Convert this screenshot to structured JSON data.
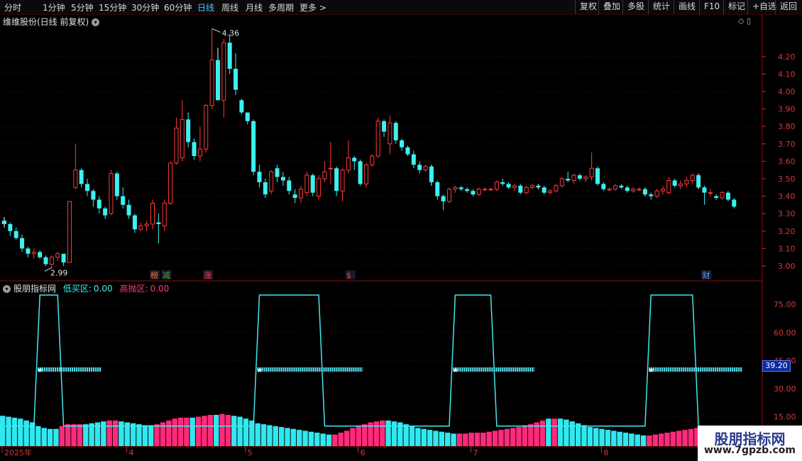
{
  "toolbar": {
    "periods": [
      "分时",
      "1分钟",
      "5分钟",
      "15分钟",
      "30分钟",
      "60分钟",
      "日线",
      "周线",
      "月线",
      "多周期",
      "更多 >"
    ],
    "active_period": "日线",
    "right_buttons": [
      "复权",
      "叠加",
      "多股",
      "统计",
      "画线",
      "F10",
      "标记",
      "+自选",
      "返回"
    ]
  },
  "chart": {
    "title": "维维股份(日线 前复权)",
    "high_label": "4.36",
    "low_label": "2.99",
    "y_ticks": [
      "4.20",
      "4.10",
      "4.00",
      "3.90",
      "3.80",
      "3.70",
      "3.60",
      "3.50",
      "3.40",
      "3.30",
      "3.20",
      "3.10",
      "3.00"
    ],
    "markers": [
      {
        "text": "榜",
        "color": "#ff7030"
      },
      {
        "text": "减",
        "color": "#2fb52f"
      },
      {
        "text": "涨",
        "color": "#ff4040"
      },
      {
        "text": "$",
        "color": "#ff4040"
      },
      {
        "text": "财",
        "color": "#4aa0ff"
      }
    ]
  },
  "indicator": {
    "name": "股朋指标网",
    "low_buy_label": "低买区:",
    "low_buy_value": "0.00",
    "high_sell_label": "高抛区:",
    "high_sell_value": "0.00",
    "y_ticks": [
      "75.00",
      "60.00",
      "45.00",
      "30.00",
      "15.00"
    ],
    "current_value": "39.20"
  },
  "x_axis": {
    "labels": [
      "2025年",
      "4",
      "5",
      "6",
      "7",
      "8"
    ]
  },
  "watermark": {
    "title": "股朋指标网",
    "url": "www.7gpzb.com"
  },
  "colors": {
    "up": "#ff3a3a",
    "down": "#3ef0f0",
    "pink": "#ff2a7a",
    "accent_active": "#4ec0ff"
  },
  "candles": [
    [
      3.26,
      3.28,
      3.22,
      3.24
    ],
    [
      3.24,
      3.25,
      3.17,
      3.2
    ],
    [
      3.2,
      3.22,
      3.15,
      3.16
    ],
    [
      3.16,
      3.18,
      3.08,
      3.1
    ],
    [
      3.1,
      3.11,
      3.05,
      3.07
    ],
    [
      3.07,
      3.1,
      3.04,
      3.08
    ],
    [
      3.08,
      3.09,
      3.04,
      3.05
    ],
    [
      3.05,
      3.06,
      3.0,
      3.01
    ],
    [
      3.01,
      3.06,
      2.99,
      3.05
    ],
    [
      3.05,
      3.08,
      3.03,
      3.07
    ],
    [
      3.07,
      3.07,
      3.0,
      3.02
    ],
    [
      3.02,
      3.37,
      3.02,
      3.37
    ],
    [
      3.45,
      3.7,
      3.44,
      3.55
    ],
    [
      3.55,
      3.56,
      3.45,
      3.47
    ],
    [
      3.47,
      3.5,
      3.4,
      3.43
    ],
    [
      3.43,
      3.44,
      3.34,
      3.38
    ],
    [
      3.38,
      3.4,
      3.3,
      3.33
    ],
    [
      3.33,
      3.34,
      3.27,
      3.29
    ],
    [
      3.3,
      3.55,
      3.29,
      3.53
    ],
    [
      3.53,
      3.54,
      3.38,
      3.4
    ],
    [
      3.4,
      3.45,
      3.33,
      3.35
    ],
    [
      3.35,
      3.38,
      3.27,
      3.29
    ],
    [
      3.29,
      3.3,
      3.19,
      3.21
    ],
    [
      3.21,
      3.25,
      3.2,
      3.23
    ],
    [
      3.23,
      3.26,
      3.2,
      3.24
    ],
    [
      3.24,
      3.38,
      3.21,
      3.36
    ],
    [
      3.25,
      3.3,
      3.13,
      3.24
    ],
    [
      3.23,
      3.38,
      3.2,
      3.36
    ],
    [
      3.36,
      3.6,
      3.35,
      3.59
    ],
    [
      3.59,
      3.85,
      3.58,
      3.79
    ],
    [
      3.62,
      3.95,
      3.6,
      3.84
    ],
    [
      3.84,
      3.88,
      3.68,
      3.71
    ],
    [
      3.71,
      3.73,
      3.61,
      3.63
    ],
    [
      3.63,
      3.8,
      3.6,
      3.67
    ],
    [
      3.67,
      3.93,
      3.65,
      3.92
    ],
    [
      3.92,
      4.36,
      3.9,
      4.18
    ],
    [
      4.18,
      4.25,
      4.05,
      3.95
    ],
    [
      3.95,
      4.3,
      3.85,
      4.28
    ],
    [
      4.28,
      4.33,
      4.1,
      4.13
    ],
    [
      4.13,
      4.22,
      3.98,
      4.01
    ],
    [
      3.95,
      3.96,
      3.87,
      3.88
    ],
    [
      3.88,
      3.88,
      3.81,
      3.83
    ],
    [
      3.83,
      3.84,
      3.52,
      3.54
    ],
    [
      3.54,
      3.58,
      3.45,
      3.48
    ],
    [
      3.48,
      3.5,
      3.39,
      3.41
    ],
    [
      3.43,
      3.55,
      3.41,
      3.54
    ],
    [
      3.56,
      3.58,
      3.48,
      3.51
    ],
    [
      3.51,
      3.54,
      3.46,
      3.49
    ],
    [
      3.49,
      3.51,
      3.41,
      3.43
    ],
    [
      3.41,
      3.44,
      3.36,
      3.39
    ],
    [
      3.39,
      3.46,
      3.36,
      3.44
    ],
    [
      3.42,
      3.54,
      3.4,
      3.52
    ],
    [
      3.52,
      3.53,
      3.4,
      3.42
    ],
    [
      3.4,
      3.52,
      3.38,
      3.5
    ],
    [
      3.5,
      3.6,
      3.48,
      3.54
    ],
    [
      3.56,
      3.71,
      3.47,
      3.56
    ],
    [
      3.56,
      3.57,
      3.4,
      3.43
    ],
    [
      3.43,
      3.56,
      3.37,
      3.55
    ],
    [
      3.55,
      3.72,
      3.53,
      3.62
    ],
    [
      3.62,
      3.63,
      3.55,
      3.6
    ],
    [
      3.6,
      3.61,
      3.46,
      3.47
    ],
    [
      3.47,
      3.59,
      3.45,
      3.58
    ],
    [
      3.58,
      3.64,
      3.57,
      3.63
    ],
    [
      3.63,
      3.85,
      3.62,
      3.83
    ],
    [
      3.83,
      3.84,
      3.74,
      3.77
    ],
    [
      3.7,
      3.86,
      3.64,
      3.82
    ],
    [
      3.82,
      3.83,
      3.7,
      3.72
    ],
    [
      3.72,
      3.73,
      3.66,
      3.68
    ],
    [
      3.68,
      3.69,
      3.63,
      3.64
    ],
    [
      3.64,
      3.66,
      3.56,
      3.58
    ],
    [
      3.58,
      3.6,
      3.53,
      3.55
    ],
    [
      3.55,
      3.58,
      3.54,
      3.57
    ],
    [
      3.57,
      3.58,
      3.46,
      3.48
    ],
    [
      3.48,
      3.49,
      3.38,
      3.4
    ],
    [
      3.4,
      3.41,
      3.32,
      3.37
    ],
    [
      3.37,
      3.45,
      3.36,
      3.44
    ],
    [
      3.44,
      3.46,
      3.42,
      3.45
    ],
    [
      3.45,
      3.46,
      3.43,
      3.44
    ],
    [
      3.44,
      3.45,
      3.42,
      3.43
    ],
    [
      3.43,
      3.44,
      3.4,
      3.41
    ],
    [
      3.41,
      3.45,
      3.4,
      3.44
    ],
    [
      3.44,
      3.45,
      3.43,
      3.44
    ],
    [
      3.44,
      3.45,
      3.43,
      3.44
    ],
    [
      3.44,
      3.49,
      3.43,
      3.48
    ],
    [
      3.48,
      3.5,
      3.46,
      3.47
    ],
    [
      3.47,
      3.48,
      3.44,
      3.45
    ],
    [
      3.45,
      3.47,
      3.43,
      3.46
    ],
    [
      3.46,
      3.47,
      3.41,
      3.42
    ],
    [
      3.42,
      3.46,
      3.41,
      3.45
    ],
    [
      3.45,
      3.47,
      3.44,
      3.46
    ],
    [
      3.46,
      3.47,
      3.44,
      3.45
    ],
    [
      3.45,
      3.46,
      3.41,
      3.42
    ],
    [
      3.42,
      3.44,
      3.41,
      3.43
    ],
    [
      3.43,
      3.47,
      3.42,
      3.46
    ],
    [
      3.46,
      3.51,
      3.45,
      3.5
    ],
    [
      3.5,
      3.54,
      3.48,
      3.49
    ],
    [
      3.49,
      3.53,
      3.47,
      3.52
    ],
    [
      3.52,
      3.53,
      3.49,
      3.5
    ],
    [
      3.5,
      3.52,
      3.48,
      3.51
    ],
    [
      3.51,
      3.65,
      3.49,
      3.56
    ],
    [
      3.56,
      3.57,
      3.46,
      3.47
    ],
    [
      3.47,
      3.48,
      3.43,
      3.44
    ],
    [
      3.44,
      3.45,
      3.43,
      3.44
    ],
    [
      3.44,
      3.47,
      3.43,
      3.46
    ],
    [
      3.46,
      3.47,
      3.44,
      3.45
    ],
    [
      3.45,
      3.46,
      3.42,
      3.43
    ],
    [
      3.43,
      3.45,
      3.42,
      3.44
    ],
    [
      3.44,
      3.45,
      3.43,
      3.44
    ],
    [
      3.44,
      3.45,
      3.4,
      3.41
    ],
    [
      3.41,
      3.42,
      3.38,
      3.4
    ],
    [
      3.4,
      3.44,
      3.39,
      3.43
    ],
    [
      3.43,
      3.46,
      3.41,
      3.44
    ],
    [
      3.42,
      3.51,
      3.41,
      3.49
    ],
    [
      3.49,
      3.5,
      3.45,
      3.46
    ],
    [
      3.46,
      3.49,
      3.44,
      3.47
    ],
    [
      3.47,
      3.51,
      3.45,
      3.49
    ],
    [
      3.49,
      3.53,
      3.47,
      3.52
    ],
    [
      3.52,
      3.53,
      3.44,
      3.45
    ],
    [
      3.45,
      3.46,
      3.35,
      3.42
    ],
    [
      3.42,
      3.44,
      3.4,
      3.42
    ],
    [
      3.4,
      3.41,
      3.38,
      3.39
    ],
    [
      3.39,
      3.43,
      3.38,
      3.42
    ],
    [
      3.42,
      3.43,
      3.37,
      3.38
    ],
    [
      3.38,
      3.39,
      3.33,
      3.34
    ]
  ],
  "cyan_line": [
    10,
    10,
    10,
    10,
    10,
    10,
    80,
    80,
    80,
    80,
    10,
    10,
    10,
    10,
    10,
    10,
    10,
    10,
    10,
    10,
    10,
    10,
    10,
    10,
    10,
    10,
    10,
    10,
    10,
    10,
    10,
    10,
    10,
    10,
    10,
    10,
    10,
    10,
    10,
    10,
    10,
    10,
    10,
    80,
    80,
    80,
    80,
    80,
    80,
    80,
    80,
    80,
    80,
    80,
    10,
    10,
    10,
    10,
    10,
    10,
    10,
    10,
    10,
    10,
    10,
    10,
    10,
    10,
    10,
    10,
    10,
    10,
    10,
    10,
    10,
    10,
    80,
    80,
    80,
    80,
    80,
    80,
    80,
    10,
    10,
    10,
    10,
    10,
    10,
    10,
    10,
    10,
    10,
    10,
    10,
    10,
    10,
    10,
    10,
    10,
    10,
    10,
    10,
    10,
    10,
    10,
    10,
    10,
    10,
    80,
    80,
    80,
    80,
    80,
    80,
    80,
    80,
    10,
    10,
    10,
    10,
    10,
    10,
    10,
    10
  ],
  "volume_bars": [
    [
      15.5,
      "c"
    ],
    [
      15.0,
      "c"
    ],
    [
      14.5,
      "c"
    ],
    [
      14.0,
      "c"
    ],
    [
      13.0,
      "c"
    ],
    [
      12.0,
      "c"
    ],
    [
      10.0,
      "c"
    ],
    [
      9.0,
      "c"
    ],
    [
      8.5,
      "c"
    ],
    [
      8.5,
      "c"
    ],
    [
      10.0,
      "p"
    ],
    [
      11.0,
      "p"
    ],
    [
      11.0,
      "p"
    ],
    [
      11.0,
      "p"
    ],
    [
      11.0,
      "c"
    ],
    [
      11.5,
      "c"
    ],
    [
      12.0,
      "c"
    ],
    [
      12.5,
      "c"
    ],
    [
      13.0,
      "p"
    ],
    [
      13.0,
      "p"
    ],
    [
      12.5,
      "c"
    ],
    [
      12.0,
      "c"
    ],
    [
      11.5,
      "c"
    ],
    [
      11.0,
      "c"
    ],
    [
      10.5,
      "c"
    ],
    [
      10.5,
      "c"
    ],
    [
      11.0,
      "p"
    ],
    [
      12.0,
      "p"
    ],
    [
      13.0,
      "p"
    ],
    [
      14.0,
      "p"
    ],
    [
      14.5,
      "p"
    ],
    [
      14.5,
      "p"
    ],
    [
      14.5,
      "c"
    ],
    [
      15.0,
      "p"
    ],
    [
      15.5,
      "p"
    ],
    [
      16.0,
      "p"
    ],
    [
      16.0,
      "c"
    ],
    [
      16.5,
      "p"
    ],
    [
      16.0,
      "p"
    ],
    [
      15.5,
      "c"
    ],
    [
      15.0,
      "c"
    ],
    [
      14.0,
      "c"
    ],
    [
      13.0,
      "c"
    ],
    [
      11.5,
      "c"
    ],
    [
      11.0,
      "c"
    ],
    [
      10.5,
      "c"
    ],
    [
      10.0,
      "c"
    ],
    [
      9.5,
      "c"
    ],
    [
      9.0,
      "c"
    ],
    [
      8.5,
      "c"
    ],
    [
      8.0,
      "c"
    ],
    [
      7.5,
      "c"
    ],
    [
      7.0,
      "c"
    ],
    [
      6.5,
      "c"
    ],
    [
      6.0,
      "c"
    ],
    [
      5.5,
      "c"
    ],
    [
      5.5,
      "p"
    ],
    [
      6.5,
      "p"
    ],
    [
      7.5,
      "p"
    ],
    [
      9.0,
      "p"
    ],
    [
      10.0,
      "p"
    ],
    [
      11.0,
      "p"
    ],
    [
      12.0,
      "p"
    ],
    [
      12.5,
      "p"
    ],
    [
      13.0,
      "p"
    ],
    [
      13.0,
      "c"
    ],
    [
      12.5,
      "c"
    ],
    [
      12.0,
      "c"
    ],
    [
      11.0,
      "c"
    ],
    [
      10.0,
      "c"
    ],
    [
      9.0,
      "c"
    ],
    [
      8.5,
      "c"
    ],
    [
      8.0,
      "c"
    ],
    [
      7.5,
      "c"
    ],
    [
      7.0,
      "c"
    ],
    [
      6.5,
      "c"
    ],
    [
      6.0,
      "c"
    ],
    [
      6.0,
      "p"
    ],
    [
      6.0,
      "p"
    ],
    [
      6.5,
      "p"
    ],
    [
      6.5,
      "p"
    ],
    [
      6.5,
      "p"
    ],
    [
      7.0,
      "p"
    ],
    [
      7.5,
      "p"
    ],
    [
      8.0,
      "p"
    ],
    [
      8.5,
      "p"
    ],
    [
      9.0,
      "p"
    ],
    [
      9.5,
      "p"
    ],
    [
      10.5,
      "p"
    ],
    [
      11.0,
      "p"
    ],
    [
      12.0,
      "p"
    ],
    [
      13.0,
      "p"
    ],
    [
      14.0,
      "c"
    ],
    [
      14.0,
      "p"
    ],
    [
      14.0,
      "c"
    ],
    [
      13.5,
      "c"
    ],
    [
      12.5,
      "c"
    ],
    [
      11.5,
      "c"
    ],
    [
      10.5,
      "c"
    ],
    [
      9.5,
      "c"
    ],
    [
      9.0,
      "c"
    ],
    [
      8.5,
      "c"
    ],
    [
      8.0,
      "c"
    ],
    [
      7.5,
      "c"
    ],
    [
      7.0,
      "c"
    ],
    [
      6.5,
      "c"
    ],
    [
      6.0,
      "c"
    ],
    [
      5.5,
      "c"
    ],
    [
      5.0,
      "c"
    ],
    [
      5.0,
      "p"
    ],
    [
      5.5,
      "p"
    ],
    [
      6.0,
      "p"
    ],
    [
      6.5,
      "p"
    ],
    [
      7.0,
      "p"
    ],
    [
      7.5,
      "p"
    ],
    [
      8.0,
      "p"
    ],
    [
      8.5,
      "p"
    ],
    [
      9.0,
      "p"
    ],
    [
      9.5,
      "p"
    ],
    [
      10.0,
      "p"
    ]
  ],
  "star_segments": [
    [
      6,
      16
    ],
    [
      43,
      60
    ],
    [
      76,
      89
    ],
    [
      109,
      124
    ]
  ]
}
